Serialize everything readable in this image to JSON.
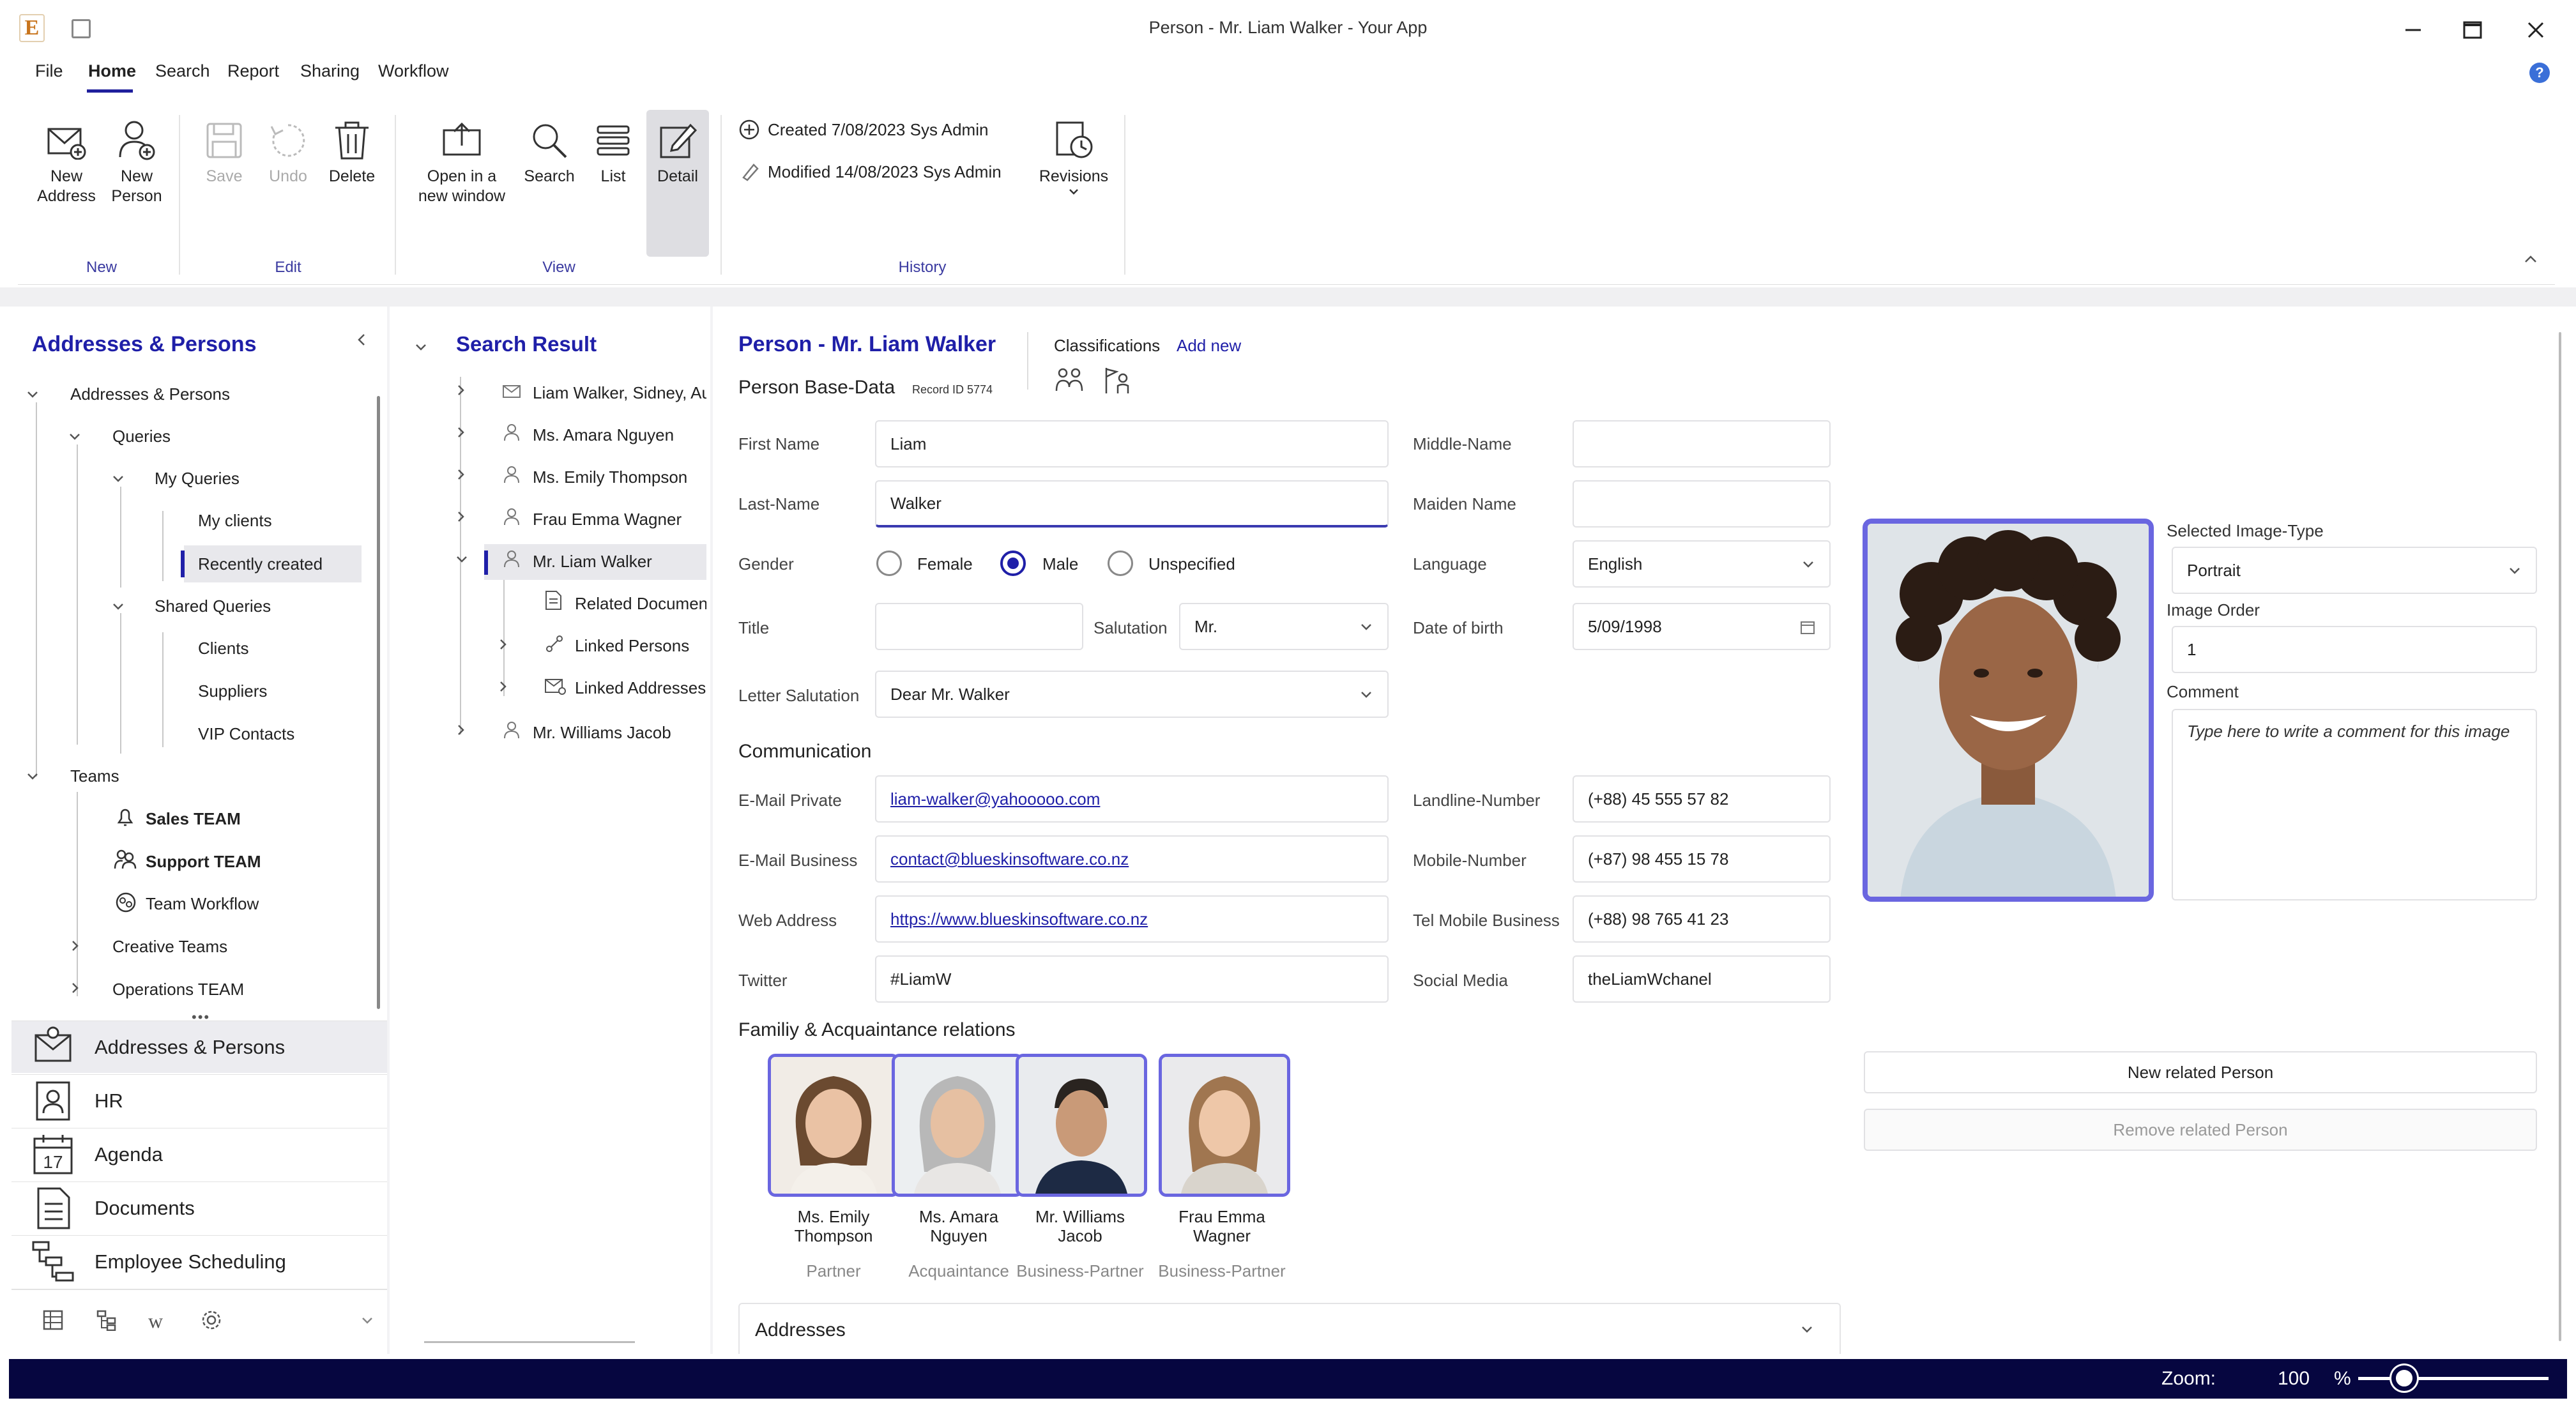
{
  "window": {
    "title": "Person - Mr. Liam Walker  - Your App",
    "app_logo": "E"
  },
  "menu": [
    "File",
    "Home",
    "Search",
    "Report",
    "Sharing",
    "Workflow"
  ],
  "ribbon": {
    "new": {
      "address": [
        "New",
        "Address"
      ],
      "person": [
        "New",
        "Person"
      ],
      "group": "New"
    },
    "edit": {
      "save": "Save",
      "undo": "Undo",
      "delete": "Delete",
      "group": "Edit"
    },
    "view": {
      "open": [
        "Open in a",
        "new window"
      ],
      "search": "Search",
      "list": "List",
      "detail": "Detail",
      "group": "View"
    },
    "history": {
      "created": "Created 7/08/2023 Sys Admin",
      "modified": "Modified 14/08/2023 Sys Admin",
      "revisions": "Revisions",
      "group": "History"
    }
  },
  "nav": {
    "title": "Addresses & Persons",
    "tree": {
      "root": "Addresses & Persons",
      "queries": "Queries",
      "my_queries": "My Queries",
      "my_clients": "My clients",
      "recently_created": "Recently created",
      "shared_queries": "Shared Queries",
      "clients": "Clients",
      "suppliers": "Suppliers",
      "vip": "VIP Contacts",
      "teams": "Teams",
      "sales": "Sales TEAM",
      "support": "Support TEAM",
      "workflow": "Team Workflow",
      "creative": "Creative Teams",
      "operations": "Operations TEAM"
    },
    "modules": [
      "Addresses & Persons",
      "HR",
      "Agenda",
      "Documents",
      "Employee Scheduling"
    ],
    "agenda_day": "17"
  },
  "search_result": {
    "title": "Search Result",
    "items": [
      "Liam Walker, Sidney, Au",
      "Ms. Amara Nguyen",
      "Ms. Emily Thompson",
      "Frau Emma Wagner",
      "Mr. Liam Walker",
      "Related Documen",
      "Linked Persons",
      "Linked Addresses",
      "Mr. Williams Jacob"
    ]
  },
  "person": {
    "title": "Person - Mr. Liam Walker",
    "base_data": "Person Base-Data",
    "record_id": "Record ID  5774",
    "classifications": "Classifications",
    "add_new": "Add new",
    "labels": {
      "first_name": "First Name",
      "middle_name": "Middle-Name",
      "last_name": "Last-Name",
      "maiden_name": "Maiden Name",
      "gender": "Gender",
      "language": "Language",
      "title": "Title",
      "salutation": "Salutation",
      "dob": "Date of birth",
      "letter_salutation": "Letter Salutation",
      "communication": "Communication",
      "email_private": "E-Mail Private",
      "landline": "Landline-Number",
      "email_business": "E-Mail Business",
      "mobile": "Mobile-Number",
      "web": "Web Address",
      "tel_mobile_business": "Tel Mobile Business",
      "twitter": "Twitter",
      "social": "Social Media",
      "relations": "Familiy & Acquaintance relations",
      "addresses": "Addresses"
    },
    "values": {
      "first_name": "Liam",
      "middle_name": "",
      "last_name": "Walker",
      "maiden_name": "",
      "gender_options": [
        "Female",
        "Male",
        "Unspecified"
      ],
      "gender_selected": "Male",
      "language": "English",
      "title": "",
      "salutation": "Mr.",
      "dob": "5/09/1998",
      "letter_salutation": "Dear Mr. Walker",
      "email_private": "liam-walker@yahooooo.com",
      "landline": "(+88) 45 555 57 82",
      "email_business": "contact@blueskinsoftware.co.nz",
      "mobile": "(+87) 98 455 15 78",
      "web": "https://www.blueskinsoftware.co.nz",
      "tel_mobile_business": "(+88) 98 765 41 23",
      "twitter": "#LiamW",
      "social": "theLiamWchanel"
    },
    "relations": [
      {
        "name": [
          "Ms. Emily",
          "Thompson"
        ],
        "role": "Partner"
      },
      {
        "name": [
          "Ms. Amara",
          "Nguyen"
        ],
        "role": "Acquaintance"
      },
      {
        "name": [
          "Mr. Williams",
          "Jacob"
        ],
        "role": "Business-Partner"
      },
      {
        "name": [
          "Frau Emma",
          "Wagner"
        ],
        "role": "Business-Partner"
      }
    ],
    "image": {
      "type_label": "Selected Image-Type",
      "type_value": "Portrait",
      "order_label": "Image Order",
      "order_value": "1",
      "comment_label": "Comment",
      "comment_placeholder": "Type here to write a comment for this image"
    },
    "buttons": {
      "new_related": "New related Person",
      "remove_related": "Remove related Person"
    }
  },
  "status": {
    "zoom_label": "Zoom:",
    "zoom_value": "100",
    "zoom_unit": "%",
    "zoom_level": 0.24
  },
  "colors": {
    "accent": "#1f1fa8",
    "photo_border": "#6a66e0",
    "status_bar": "#060640"
  }
}
